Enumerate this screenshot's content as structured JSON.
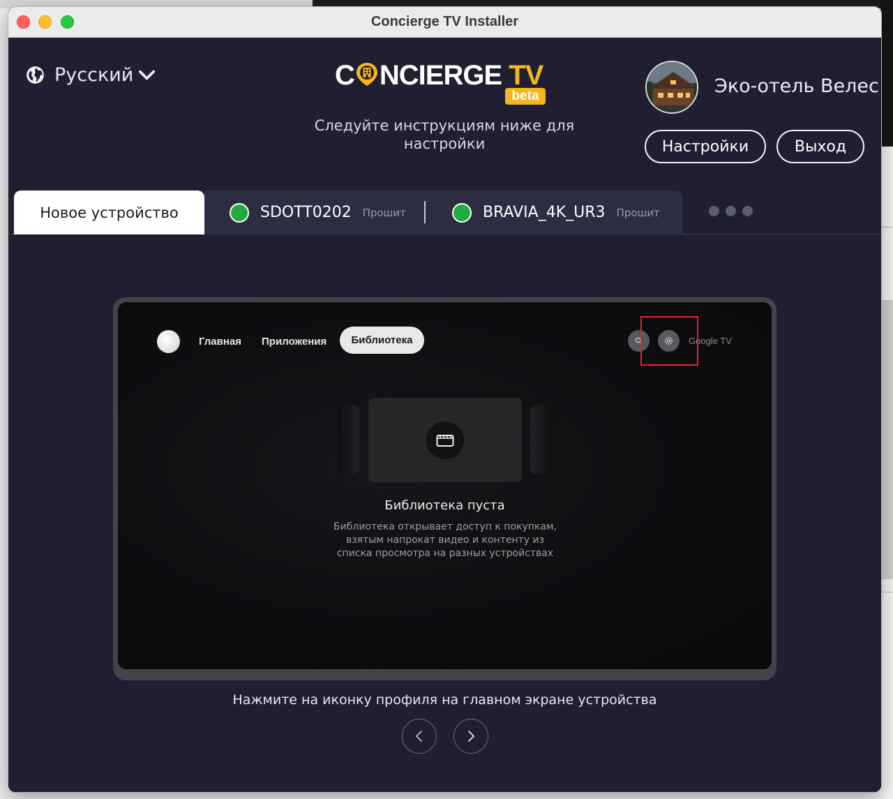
{
  "window": {
    "title": "Concierge TV Installer"
  },
  "language": {
    "label": "Русский",
    "icon": "globe-icon"
  },
  "logo": {
    "part1": "C",
    "part2": "NCIERGE",
    "tv": "TV",
    "badge": "beta",
    "accent": "#f5b51f"
  },
  "subtitle": "Следуйте инструкциям ниже для настройки",
  "profile": {
    "name": "Эко-отель Велес"
  },
  "buttons": {
    "settings": "Настройки",
    "logout": "Выход"
  },
  "tabs": {
    "new_device": "Новое устройство",
    "devices": [
      {
        "name": "SDOTT0202",
        "status": "Прошит",
        "status_color": "#1fac3d"
      },
      {
        "name": "BRAVIA_4K_UR3",
        "status": "Прошит",
        "status_color": "#1fac3d"
      }
    ]
  },
  "tv_screen": {
    "nav": {
      "home": "Главная",
      "apps": "Приложения",
      "library": "Библиотека"
    },
    "brand": "Google TV",
    "empty_title": "Библиотека пуста",
    "empty_desc": "Библиотека открывает доступ к покупкам, взятым напрокат видео и контенту из списка просмотра на разных устройствах",
    "highlight_color": "#e0262b"
  },
  "instruction": "Нажмите на иконку профиля на главном экране устройства",
  "colors": {
    "background": "#1f1f31",
    "tab_bar": "#2d2d41"
  }
}
